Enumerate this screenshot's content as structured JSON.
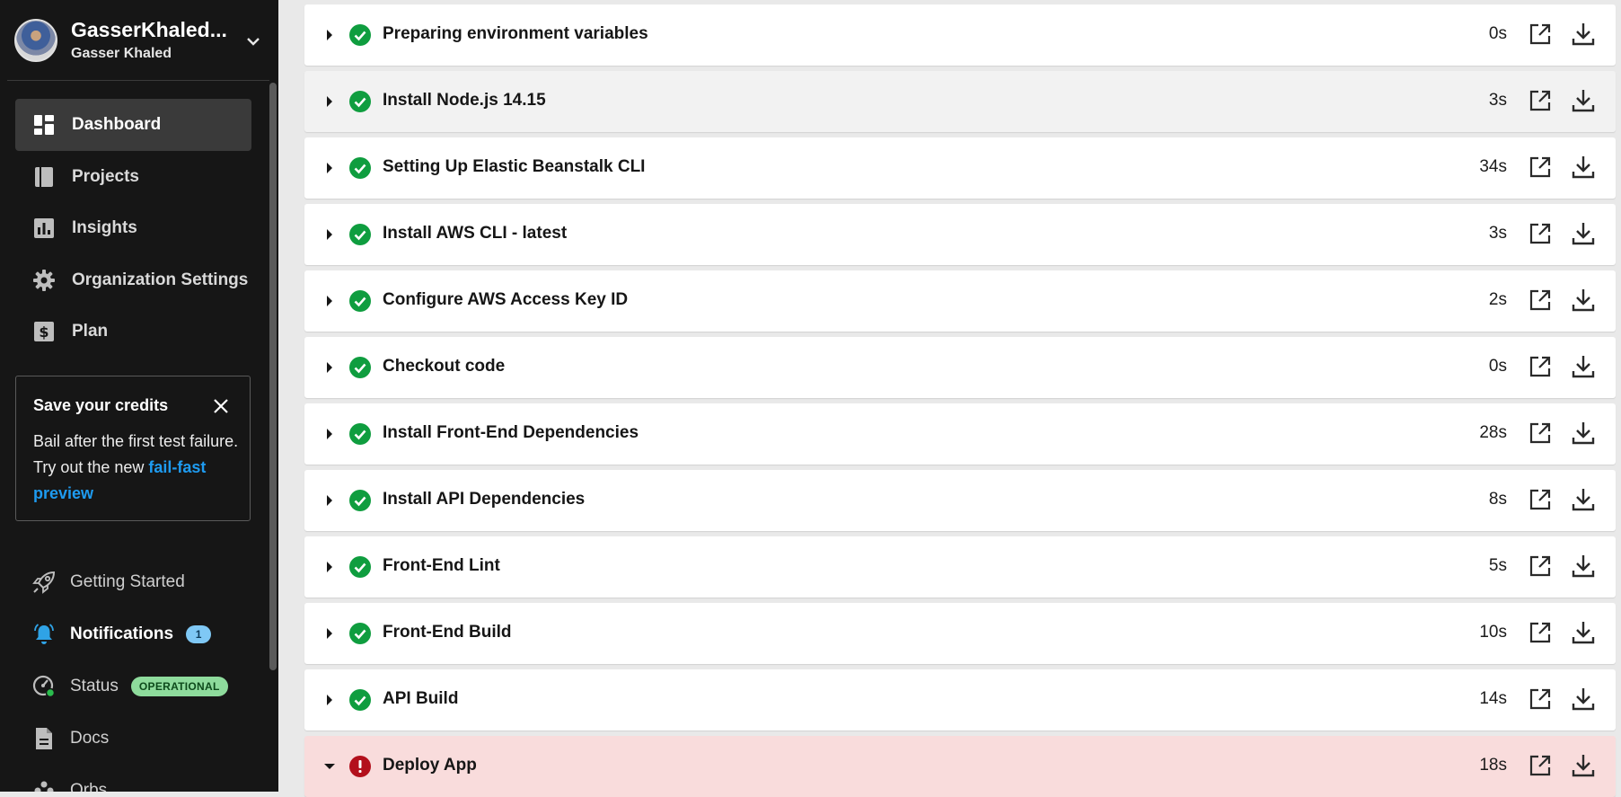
{
  "user": {
    "org": "GasserKhaled...",
    "name": "Gasser Khaled"
  },
  "nav": [
    {
      "label": "Dashboard",
      "icon": "dashboard-icon",
      "active": true
    },
    {
      "label": "Projects",
      "icon": "projects-icon",
      "active": false
    },
    {
      "label": "Insights",
      "icon": "insights-icon",
      "active": false
    },
    {
      "label": "Organization Settings",
      "icon": "gear-icon",
      "active": false
    },
    {
      "label": "Plan",
      "icon": "dollar-icon",
      "active": false
    }
  ],
  "promo": {
    "title": "Save your credits",
    "body": "Bail after the first test failure. Try out the new ",
    "link": "fail-fast preview"
  },
  "secondary_nav": {
    "getting_started": "Getting Started",
    "notifications": "Notifications",
    "notifications_count": "1",
    "status": "Status",
    "status_badge": "OPERATIONAL",
    "docs": "Docs",
    "orbs": "Orbs"
  },
  "steps": [
    {
      "name": "Preparing environment variables",
      "duration": "0s",
      "status": "success"
    },
    {
      "name": "Install Node.js 14.15",
      "duration": "3s",
      "status": "success"
    },
    {
      "name": "Setting Up Elastic Beanstalk CLI",
      "duration": "34s",
      "status": "success"
    },
    {
      "name": "Install AWS CLI - latest",
      "duration": "3s",
      "status": "success"
    },
    {
      "name": "Configure AWS Access Key ID",
      "duration": "2s",
      "status": "success"
    },
    {
      "name": "Checkout code",
      "duration": "0s",
      "status": "success"
    },
    {
      "name": "Install Front-End Dependencies",
      "duration": "28s",
      "status": "success"
    },
    {
      "name": "Install API Dependencies",
      "duration": "8s",
      "status": "success"
    },
    {
      "name": "Front-End Lint",
      "duration": "5s",
      "status": "success"
    },
    {
      "name": "Front-End Build",
      "duration": "10s",
      "status": "success"
    },
    {
      "name": "API Build",
      "duration": "14s",
      "status": "success"
    },
    {
      "name": "Deploy App",
      "duration": "18s",
      "status": "failed"
    }
  ],
  "colors": {
    "success": "#0f9d3f",
    "failed": "#b3101c",
    "link": "#1e9bf0",
    "sidebar": "#161616"
  }
}
